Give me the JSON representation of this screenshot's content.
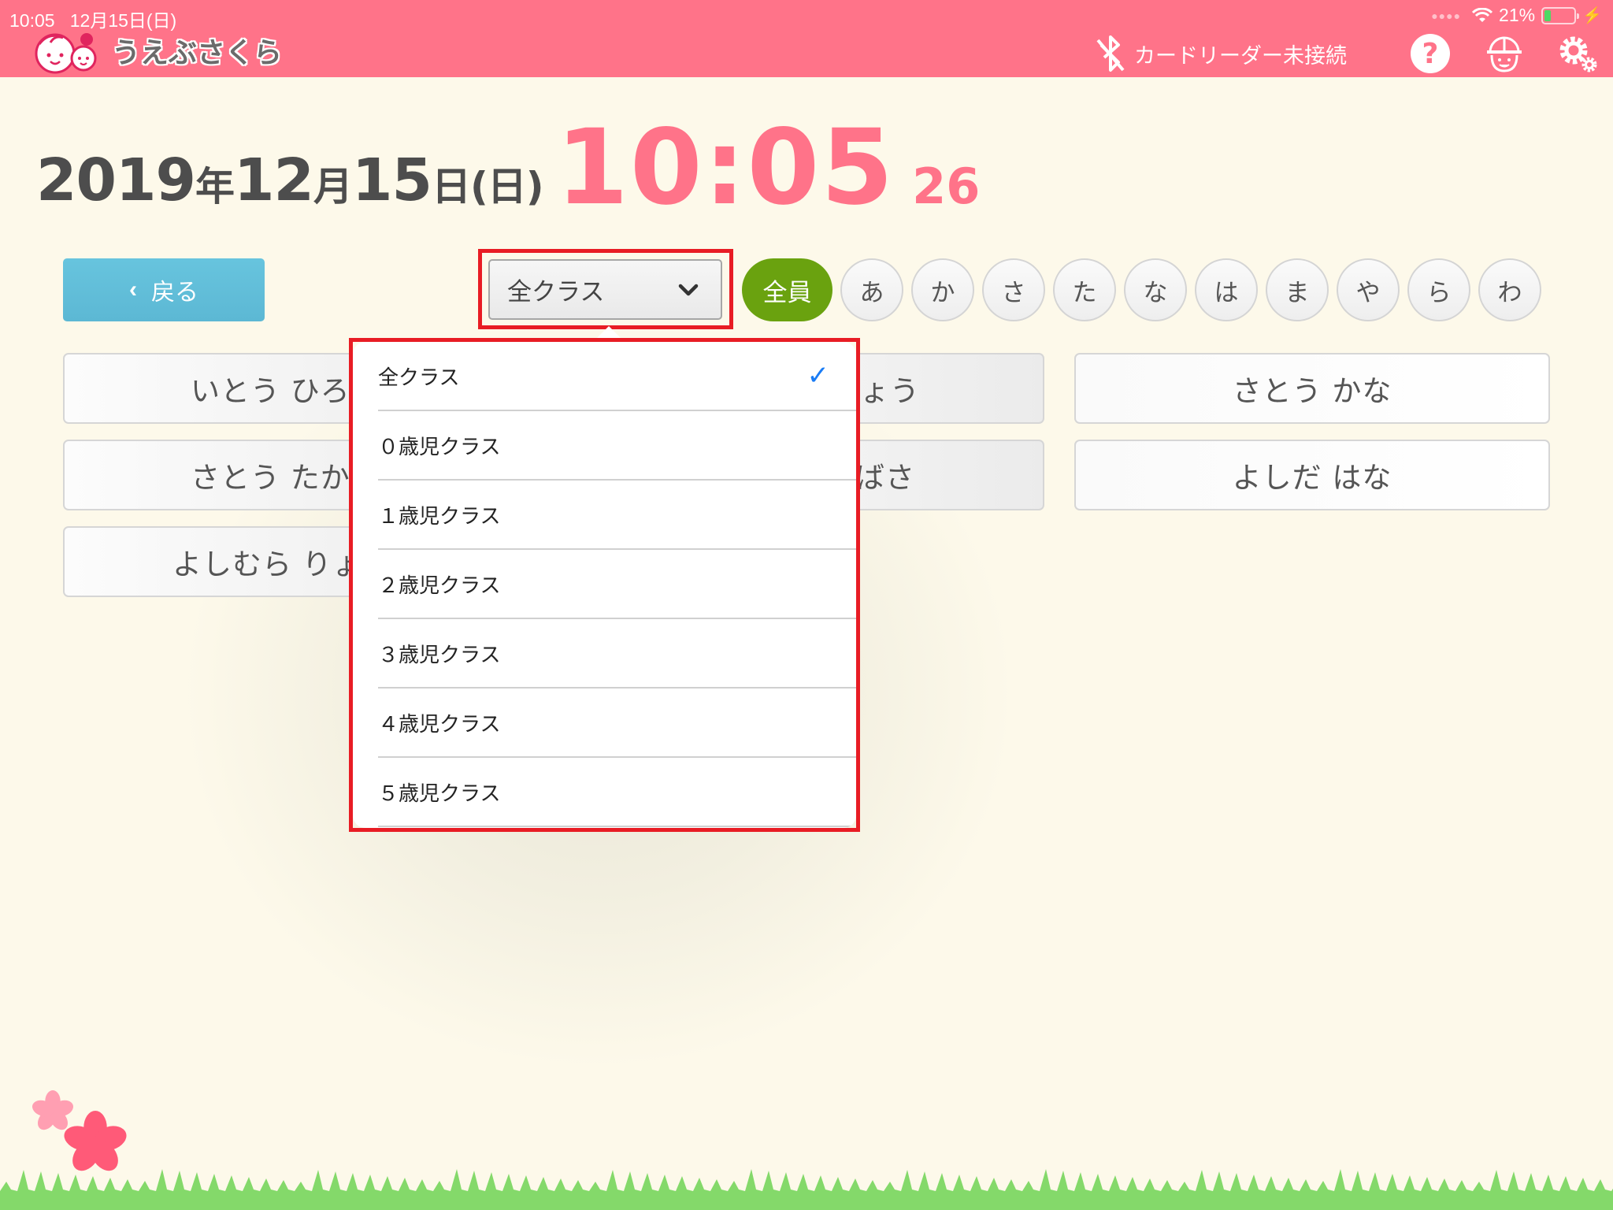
{
  "status_bar": {
    "time": "10:05",
    "date": "12月15日(日)",
    "battery_percent_label": "21%",
    "battery_level": 0.21
  },
  "header": {
    "app_name": "うえぶさくら",
    "card_reader_status": "カードリーダー未接続",
    "icons": [
      "bluetooth-off-icon",
      "help-icon",
      "child-icon",
      "settings-icon"
    ]
  },
  "datetime": {
    "year": "2019",
    "year_unit": "年",
    "month": "12",
    "month_unit": "月",
    "day": "15",
    "day_unit": "日",
    "weekday": "(日)",
    "hour_minute": "10:05",
    "seconds": "26"
  },
  "toolbar": {
    "back_label": "戻る",
    "class_select_value": "全クラス",
    "kana_filters": [
      "全員",
      "あ",
      "か",
      "さ",
      "た",
      "な",
      "は",
      "ま",
      "や",
      "ら",
      "わ"
    ],
    "kana_selected": "全員"
  },
  "children": [
    "いとう ひろ",
    "ょう",
    "さとう かな",
    "さとう たか",
    "ばさ",
    "よしだ はな",
    "よしむら りょ"
  ],
  "class_dropdown": {
    "options": [
      "全クラス",
      "０歳児クラス",
      "１歳児クラス",
      "２歳児クラス",
      "３歳児クラス",
      "４歳児クラス",
      "５歳児クラス"
    ],
    "selected": "全クラス"
  },
  "colors": {
    "header": "#ff7389",
    "clock": "#ff7389",
    "back_button": "#5cb8d4",
    "kana_active": "#6aa20f",
    "highlight": "#e81c24",
    "check": "#1a7cf5"
  }
}
